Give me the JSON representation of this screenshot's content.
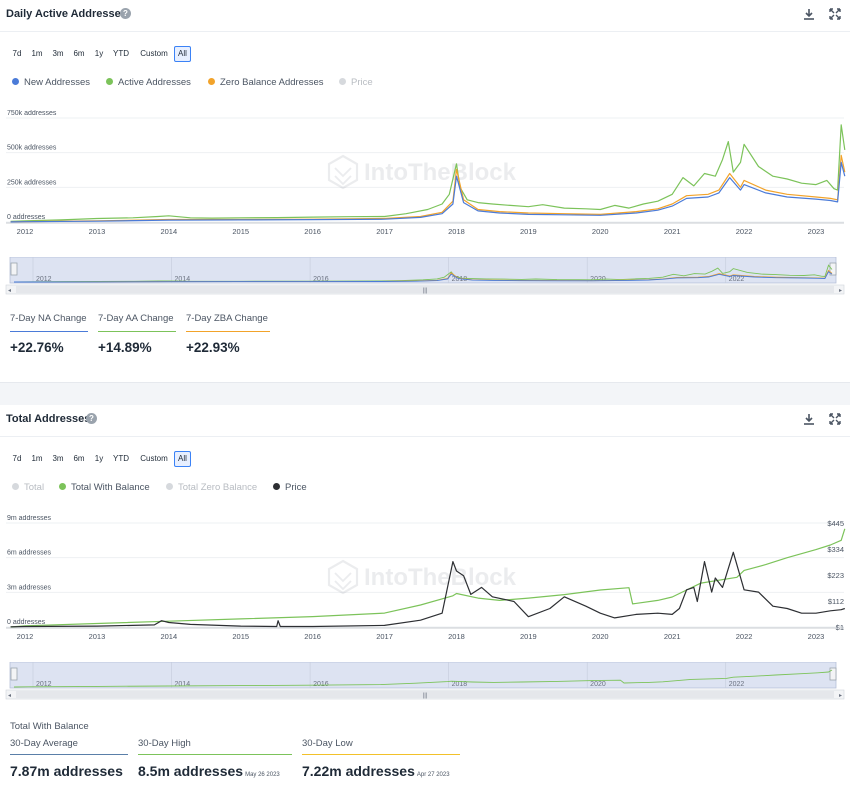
{
  "panel1": {
    "title": "Daily Active Addresses",
    "range_buttons": [
      "7d",
      "1m",
      "3m",
      "6m",
      "1y",
      "YTD",
      "Custom",
      "All"
    ],
    "active_range": "All",
    "legend": [
      {
        "label": "New Addresses",
        "color": "#4b7bd8",
        "enabled": true
      },
      {
        "label": "Active Addresses",
        "color": "#7cc35a",
        "enabled": true
      },
      {
        "label": "Zero Balance Addresses",
        "color": "#f2a32a",
        "enabled": true
      },
      {
        "label": "Price",
        "color": "#c9cdd2",
        "enabled": false
      }
    ],
    "watermark": "IntoTheBlock",
    "stats": [
      {
        "label": "7-Day NA Change",
        "value": "+22.76%",
        "underline": "#4b7bd8"
      },
      {
        "label": "7-Day AA Change",
        "value": "+14.89%",
        "underline": "#7cc35a"
      },
      {
        "label": "7-Day ZBA Change",
        "value": "+22.93%",
        "underline": "#f2a32a"
      }
    ]
  },
  "panel2": {
    "title": "Total Addresses",
    "range_buttons": [
      "7d",
      "1m",
      "3m",
      "6m",
      "1y",
      "YTD",
      "Custom",
      "All"
    ],
    "active_range": "All",
    "legend": [
      {
        "label": "Total",
        "color": "#c9cdd2",
        "enabled": false
      },
      {
        "label": "Total With Balance",
        "color": "#7cc35a",
        "enabled": true
      },
      {
        "label": "Total Zero Balance",
        "color": "#c9cdd2",
        "enabled": false
      },
      {
        "label": "Price",
        "color": "#2d2f33",
        "enabled": true
      }
    ],
    "watermark": "IntoTheBlock",
    "stats_title": "Total With Balance",
    "stats": [
      {
        "label": "30-Day Average",
        "value": "7.87m addresses",
        "date": "",
        "underline": "#5a7fa8"
      },
      {
        "label": "30-Day High",
        "value": "8.5m addresses",
        "date": "May 26 2023",
        "underline": "#7cc35a"
      },
      {
        "label": "30-Day Low",
        "value": "7.22m addresses",
        "date": "Apr 27 2023",
        "underline": "#f2c12a"
      }
    ]
  },
  "chart_data": [
    {
      "type": "line",
      "title": "Daily Active Addresses",
      "x_ticks": [
        "2012",
        "2013",
        "2014",
        "2015",
        "2016",
        "2017",
        "2018",
        "2019",
        "2020",
        "2021",
        "2022",
        "2023"
      ],
      "y_ticks": [
        "0 addresses",
        "250k addresses",
        "500k addresses",
        "750k addresses"
      ],
      "ylim": [
        0,
        750000
      ],
      "grid": true,
      "legend_position": "top-left",
      "series": [
        {
          "name": "Active Addresses",
          "color": "#7cc35a",
          "x": [
            2011.8,
            2012,
            2012.5,
            2013,
            2013.5,
            2013.85,
            2014,
            2014.3,
            2014.6,
            2015,
            2015.5,
            2016,
            2016.5,
            2017,
            2017.3,
            2017.6,
            2017.8,
            2017.9,
            2018,
            2018.05,
            2018.15,
            2018.3,
            2018.5,
            2018.75,
            2019,
            2019.2,
            2019.5,
            2019.8,
            2020,
            2020.2,
            2020.4,
            2020.6,
            2020.8,
            2021,
            2021.15,
            2021.3,
            2021.45,
            2021.6,
            2021.7,
            2021.78,
            2021.85,
            2021.95,
            2022,
            2022.2,
            2022.4,
            2022.6,
            2022.8,
            2023,
            2023.15,
            2023.25,
            2023.3,
            2023.35,
            2023.4
          ],
          "y": [
            5000,
            8000,
            15000,
            25000,
            30000,
            40000,
            45000,
            30000,
            28000,
            30000,
            32000,
            35000,
            38000,
            40000,
            60000,
            90000,
            130000,
            200000,
            420000,
            250000,
            160000,
            140000,
            130000,
            120000,
            110000,
            125000,
            100000,
            95000,
            90000,
            120000,
            100000,
            130000,
            150000,
            200000,
            320000,
            260000,
            350000,
            330000,
            450000,
            580000,
            360000,
            430000,
            560000,
            400000,
            330000,
            310000,
            280000,
            270000,
            300000,
            240000,
            230000,
            700000,
            520000
          ]
        },
        {
          "name": "Zero Balance Addresses",
          "color": "#f2a32a",
          "x": [
            2011.8,
            2012,
            2013,
            2014,
            2015,
            2016,
            2017,
            2017.5,
            2017.8,
            2017.95,
            2018,
            2018.1,
            2018.3,
            2018.6,
            2019,
            2019.5,
            2020,
            2020.5,
            2020.8,
            2021,
            2021.2,
            2021.5,
            2021.65,
            2021.8,
            2021.95,
            2022,
            2022.3,
            2022.6,
            2023,
            2023.2,
            2023.3,
            2023.35,
            2023.4
          ],
          "y": [
            1000,
            3000,
            8000,
            18000,
            18000,
            20000,
            25000,
            40000,
            70000,
            150000,
            380000,
            160000,
            90000,
            75000,
            65000,
            60000,
            55000,
            75000,
            95000,
            130000,
            190000,
            200000,
            230000,
            350000,
            250000,
            300000,
            230000,
            200000,
            180000,
            170000,
            160000,
            480000,
            360000
          ]
        },
        {
          "name": "New Addresses",
          "color": "#4b7bd8",
          "x": [
            2011.8,
            2012,
            2013,
            2014,
            2015,
            2016,
            2017,
            2017.5,
            2017.8,
            2017.95,
            2018,
            2018.1,
            2018.3,
            2018.6,
            2019,
            2019.5,
            2020,
            2020.5,
            2020.8,
            2021,
            2021.2,
            2021.5,
            2021.65,
            2021.8,
            2021.95,
            2022,
            2022.3,
            2022.6,
            2023,
            2023.2,
            2023.3,
            2023.35,
            2023.4
          ],
          "y": [
            1000,
            2000,
            6000,
            14000,
            15000,
            17000,
            20000,
            33000,
            60000,
            130000,
            330000,
            140000,
            80000,
            65000,
            55000,
            52000,
            48000,
            65000,
            85000,
            115000,
            170000,
            180000,
            210000,
            320000,
            230000,
            270000,
            210000,
            180000,
            165000,
            155000,
            145000,
            430000,
            330000
          ]
        }
      ]
    },
    {
      "type": "line",
      "title": "Total Addresses",
      "x_ticks": [
        "2012",
        "2013",
        "2014",
        "2015",
        "2016",
        "2017",
        "2018",
        "2019",
        "2020",
        "2021",
        "2022",
        "2023"
      ],
      "y_ticks": [
        "0 addresses",
        "3m addresses",
        "6m addresses",
        "9m addresses"
      ],
      "y2_ticks": [
        "$1",
        "$112",
        "$223",
        "$334",
        "$445"
      ],
      "ylim": [
        0,
        9000000
      ],
      "y2lim": [
        1,
        445
      ],
      "grid": true,
      "legend_position": "top-left",
      "series": [
        {
          "name": "Total With Balance",
          "color": "#7cc35a",
          "axis": "left",
          "x": [
            2011.8,
            2012,
            2013,
            2014,
            2015,
            2016,
            2017,
            2017.5,
            2017.95,
            2018,
            2018.3,
            2018.6,
            2019,
            2019.5,
            2020,
            2020.4,
            2020.45,
            2020.8,
            2021,
            2021.4,
            2021.9,
            2022,
            2022.3,
            2022.6,
            2023,
            2023.2,
            2023.35,
            2023.4
          ],
          "y": [
            0,
            100000,
            300000,
            500000,
            700000,
            900000,
            1200000,
            1900000,
            2700000,
            2900000,
            2500000,
            2300000,
            2500000,
            2800000,
            3200000,
            3400000,
            2000000,
            2300000,
            2600000,
            3800000,
            4300000,
            4900000,
            5400000,
            6000000,
            6700000,
            7100000,
            7500000,
            8500000
          ]
        },
        {
          "name": "Price",
          "color": "#2d2f33",
          "axis": "right",
          "x": [
            2011.8,
            2012,
            2013,
            2013.8,
            2013.9,
            2014,
            2014.3,
            2015,
            2015.5,
            2015.52,
            2015.55,
            2016,
            2017,
            2017.5,
            2017.8,
            2017.95,
            2018,
            2018.1,
            2018.2,
            2018.35,
            2018.5,
            2018.8,
            2019,
            2019.3,
            2019.5,
            2019.8,
            2020,
            2020.2,
            2020.5,
            2020.8,
            2021,
            2021.1,
            2021.2,
            2021.3,
            2021.35,
            2021.45,
            2021.55,
            2021.6,
            2021.7,
            2021.85,
            2022,
            2022.2,
            2022.4,
            2022.6,
            2022.8,
            2023,
            2023.2,
            2023.35,
            2023.4
          ],
          "y": [
            2,
            3,
            5,
            10,
            28,
            20,
            12,
            5,
            3,
            28,
            3,
            3,
            8,
            30,
            60,
            280,
            240,
            220,
            140,
            170,
            130,
            110,
            45,
            80,
            130,
            90,
            60,
            40,
            55,
            60,
            55,
            80,
            160,
            170,
            110,
            280,
            150,
            210,
            170,
            320,
            160,
            150,
            90,
            80,
            60,
            60,
            70,
            75,
            80
          ]
        }
      ]
    }
  ]
}
